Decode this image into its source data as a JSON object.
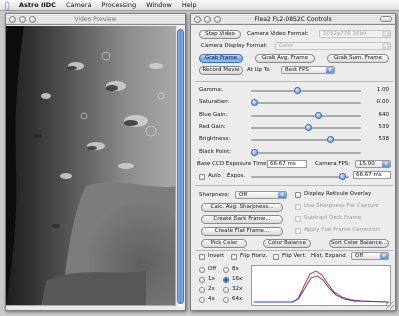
{
  "menubar": {
    "apple_icon": "apple-logo",
    "items": [
      "Astro IIDC",
      "Camera",
      "Processing",
      "Window",
      "Help"
    ]
  },
  "video_window": {
    "title": "Video Preview"
  },
  "controls_window": {
    "title": "Flea2 FL2-08S2C Controls",
    "stop_video": "Stop Video",
    "camera_video_format_label": "Camera Video Format:",
    "camera_video_format_value": "1032x776 16bit",
    "camera_display_format_label": "Camera Display Format:",
    "camera_display_format_value": "Color",
    "grab_frame": "Grab Frame",
    "grab_avg_frame": "Grab Avg. Frame",
    "grab_sum_frame": "Grab Sum. Frame",
    "record_movie": "Record Movie",
    "at_up_to": "At Up To",
    "fps_value": "Best FPS",
    "sliders": [
      {
        "label": "Gamma:",
        "value": "1.00",
        "level": 0.42
      },
      {
        "label": "Saturation:",
        "value": "0.00",
        "level": 0.0
      },
      {
        "label": "Blue Gain:",
        "value": "640",
        "level": 0.62
      },
      {
        "label": "Red Gain:",
        "value": "539",
        "level": 0.52
      },
      {
        "label": "Brightness:",
        "value": "538",
        "level": 0.74
      },
      {
        "label": "Black Point:",
        "value": "",
        "level": 0.0
      }
    ],
    "exposure_label": "Base CCD Exposure Time:",
    "exposure_value": "66.67 ms",
    "camera_fps_label": "Camera FPS:",
    "camera_fps_value": "15.00",
    "auto_label": "Auto",
    "expos_label": "Expos.",
    "expos_value": "66.67 ms",
    "expos_level": 0.97,
    "sharpness_label": "Sharpness:",
    "sharpness_value": "Off",
    "display_reticule": "Display Reticule Overlay",
    "calc_avg_sharpness": "Calc. Avg. Sharpness...",
    "use_sharpness": "Use Sharpness For Capture",
    "create_dark_frame": "Create Dark Frame...",
    "subtract_dark_frame": "Subtract Dark Frame",
    "create_flat_frame": "Create Flat Frame...",
    "apply_flat_frame": "Apply Flat Frame Correction",
    "pick_color": "Pick Color",
    "color_balance": "Color Balance",
    "sort_color_balance": "Sort Color Balance...",
    "invert": "Invert",
    "flip_horiz": "Flip Horiz.",
    "flip_vert": "Flip Vert.",
    "hist_expand": "Hist. Expand",
    "hist_expand_value": "Off",
    "zoom_options": [
      "Off",
      "1x",
      "2x",
      "4x",
      "8x",
      "16x",
      "32x",
      "64x"
    ],
    "zoom_selected": "16x",
    "colors": {
      "accent": "#5a8fd8",
      "histogram_red": "#e02020",
      "histogram_blue": "#2040e0"
    }
  }
}
